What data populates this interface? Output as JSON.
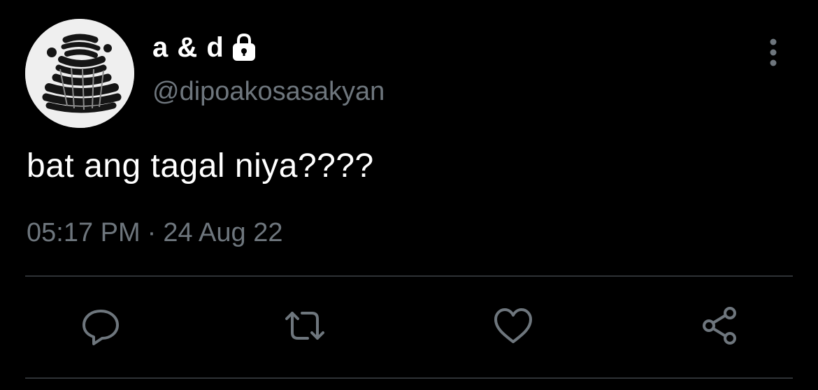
{
  "tweet": {
    "display_name": "a & d",
    "handle": "@dipoakosasakyan",
    "text": "bat ang tagal niya????",
    "time": "05:17 PM",
    "separator": "·",
    "date": "24 Aug 22",
    "protected_icon": "lock-icon",
    "more_icon": "more-vertical-icon"
  },
  "actions": [
    {
      "name": "reply",
      "icon": "comment-bubble-icon"
    },
    {
      "name": "retweet",
      "icon": "retweet-icon"
    },
    {
      "name": "like",
      "icon": "heart-icon"
    },
    {
      "name": "share",
      "icon": "share-icon"
    }
  ],
  "colors": {
    "background": "#000000",
    "primary_text": "#ffffff",
    "secondary_text": "#6e767d",
    "icon": "#6e767d",
    "divider": "#2f3336",
    "avatar_bg": "#efefef"
  }
}
